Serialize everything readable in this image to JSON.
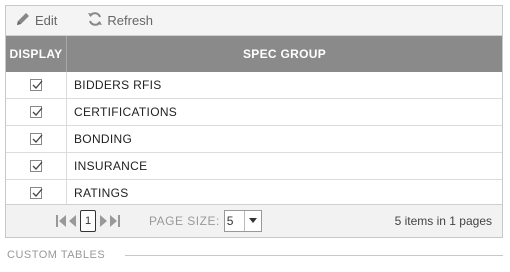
{
  "toolbar": {
    "edit_label": "Edit",
    "refresh_label": "Refresh"
  },
  "table": {
    "columns": [
      "DISPLAY",
      "SPEC GROUP"
    ],
    "rows": [
      {
        "checked": true,
        "name": "BIDDERS RFIS"
      },
      {
        "checked": true,
        "name": "CERTIFICATIONS"
      },
      {
        "checked": true,
        "name": "BONDING"
      },
      {
        "checked": true,
        "name": "INSURANCE"
      },
      {
        "checked": true,
        "name": "RATINGS"
      }
    ]
  },
  "pager": {
    "current_page": "1",
    "page_size_label": "PAGE SIZE:",
    "page_size": "5",
    "info": "5 items in 1 pages"
  },
  "section": {
    "title": "CUSTOM TABLES"
  },
  "icons": {
    "edit": "pencil-icon",
    "refresh": "refresh-icon",
    "first": "first-page-icon",
    "prev": "prev-page-icon",
    "next": "next-page-icon",
    "last": "last-page-icon",
    "dropdown": "chevron-down-icon"
  },
  "colors": {
    "header_bg": "#8a8a8a",
    "toolbar_bg": "#f4f4f4"
  }
}
